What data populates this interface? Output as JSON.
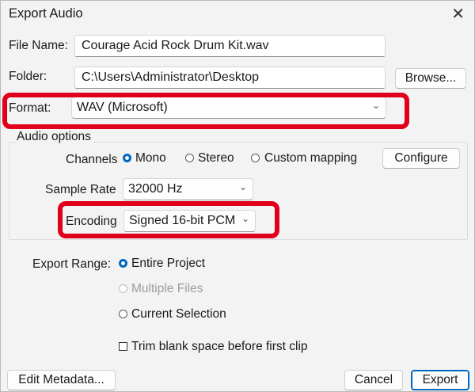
{
  "window": {
    "title": "Export Audio",
    "close_glyph": "✕"
  },
  "file": {
    "name_label": "File Name:",
    "name_value": "Courage Acid Rock Drum Kit.wav",
    "folder_label": "Folder:",
    "folder_value": "C:\\Users\\Administrator\\Desktop",
    "browse_label": "Browse..."
  },
  "format": {
    "label": "Format:",
    "value": "WAV (Microsoft)"
  },
  "audio_options": {
    "title": "Audio options",
    "channels_label": "Channels",
    "channel_options": [
      "Mono",
      "Stereo",
      "Custom mapping"
    ],
    "channel_selected": "Mono",
    "configure_label": "Configure",
    "sample_rate_label": "Sample Rate",
    "sample_rate_value": "32000 Hz",
    "encoding_label": "Encoding",
    "encoding_value": "Signed 16-bit PCM"
  },
  "export_range": {
    "label": "Export Range:",
    "options": [
      "Entire Project",
      "Multiple Files",
      "Current Selection"
    ],
    "selected": "Entire Project",
    "disabled": [
      "Multiple Files"
    ],
    "trim_label": "Trim blank space before first clip",
    "trim_checked": false
  },
  "footer": {
    "edit_metadata_label": "Edit Metadata...",
    "cancel_label": "Cancel",
    "export_label": "Export"
  },
  "colors": {
    "highlight": "#e0001b",
    "accent": "#0067c0"
  }
}
